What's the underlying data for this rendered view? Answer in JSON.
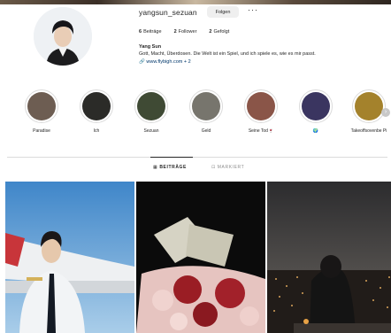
{
  "profile": {
    "username": "yangsun_sezuan",
    "follow_label": "Folgen",
    "more_label": "···",
    "stats": [
      {
        "count": "6",
        "label": "Beiträge"
      },
      {
        "count": "2",
        "label": "Follower"
      },
      {
        "count": "2",
        "label": "Gefolgt"
      }
    ],
    "display_name": "Yang Sun",
    "bio": "Gott, Macht, Überdosen. Die Welt ist ein Spiel, und ich spiele es, wie es mir passt.",
    "link": "www.flybigh.com + 2",
    "link_icon": "link-icon"
  },
  "highlights": [
    {
      "label": "Paradise",
      "color": "#6d5d52"
    },
    {
      "label": "Ich",
      "color": "#2b2b28"
    },
    {
      "label": "Sezuan",
      "color": "#3f4a34"
    },
    {
      "label": "Geld",
      "color": "#77756d"
    },
    {
      "label": "Seine Tod🍷",
      "color": "#8a5548"
    },
    {
      "label": "🌍",
      "color": "#3a3560"
    },
    {
      "label": "Takeoffsovenbe Pi",
      "color": "#a4822c"
    }
  ],
  "tabs": {
    "posts": "▦ BEITRÄGE",
    "tagged": "⊡ MARKIERT"
  },
  "colors": {
    "link": "#00376b",
    "divider": "#dbdbdb",
    "button_bg": "#efefef"
  }
}
